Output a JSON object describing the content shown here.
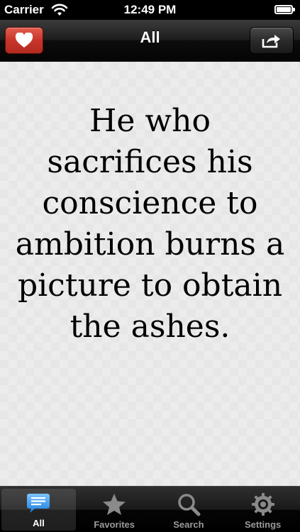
{
  "status_bar": {
    "carrier": "Carrier",
    "time": "12:49 PM"
  },
  "nav_bar": {
    "title": "All",
    "favorite_icon": "heart-icon",
    "share_icon": "share-icon"
  },
  "quote": {
    "text": "He who sacrifices his conscience to ambition burns a picture to obtain the ashes."
  },
  "tab_bar": {
    "tabs": [
      {
        "label": "All",
        "icon": "speech-bubble-icon",
        "active": true
      },
      {
        "label": "Favorites",
        "icon": "star-icon",
        "active": false
      },
      {
        "label": "Search",
        "icon": "magnifier-icon",
        "active": false
      },
      {
        "label": "Settings",
        "icon": "gear-icon",
        "active": false
      }
    ]
  },
  "colors": {
    "favorite_button": "#c8352a",
    "active_tab_icon": "#2f8ee8",
    "background": "#ececec"
  }
}
